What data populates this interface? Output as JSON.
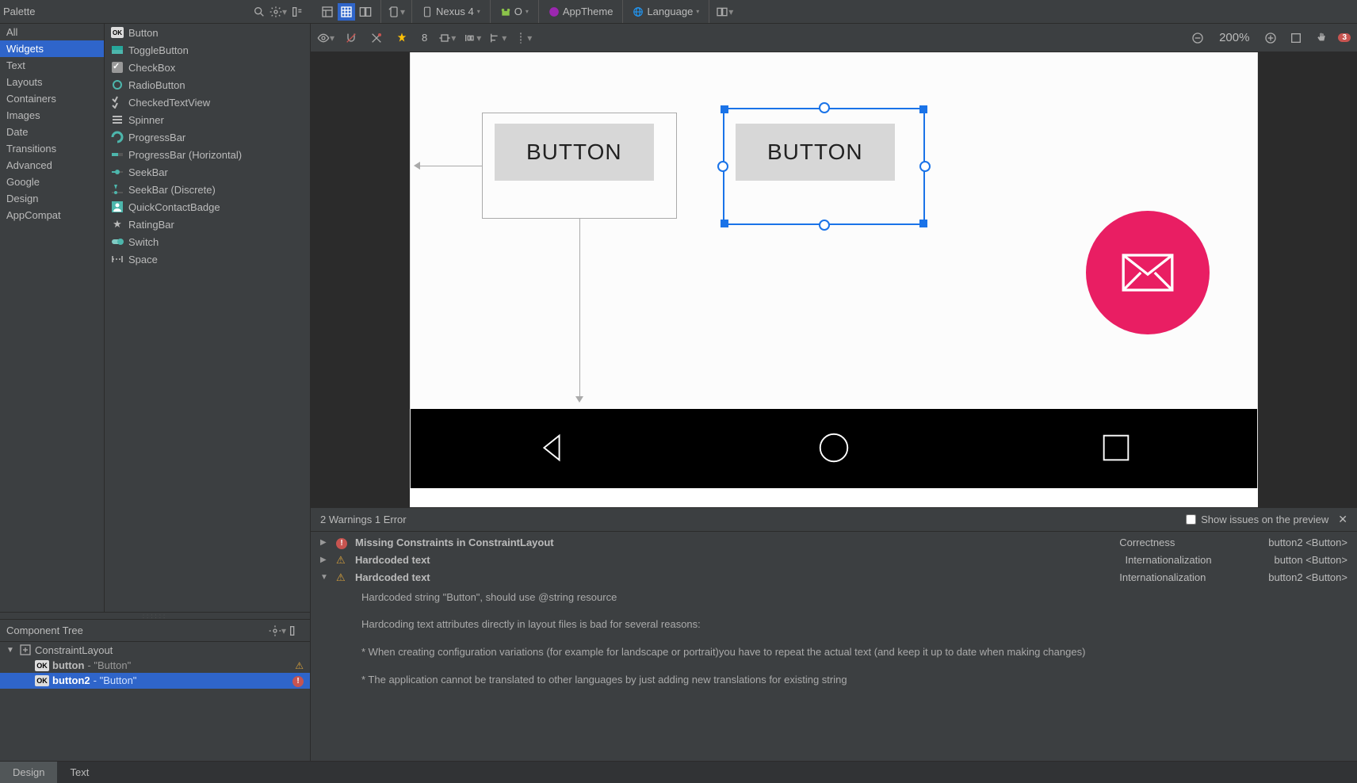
{
  "palette": {
    "title": "Palette",
    "categories": [
      "All",
      "Widgets",
      "Text",
      "Layouts",
      "Containers",
      "Images",
      "Date",
      "Transitions",
      "Advanced",
      "Google",
      "Design",
      "AppCompat"
    ],
    "selectedCategory": "Widgets",
    "items": [
      "Button",
      "ToggleButton",
      "CheckBox",
      "RadioButton",
      "CheckedTextView",
      "Spinner",
      "ProgressBar",
      "ProgressBar (Horizontal)",
      "SeekBar",
      "SeekBar (Discrete)",
      "QuickContactBadge",
      "RatingBar",
      "Switch",
      "Space"
    ]
  },
  "componentTree": {
    "title": "Component Tree",
    "root": "ConstraintLayout",
    "children": [
      {
        "id": "button",
        "type": "\"Button\"",
        "status": "warn"
      },
      {
        "id": "button2",
        "type": "\"Button\"",
        "status": "err",
        "selected": true
      }
    ]
  },
  "toolbar": {
    "device": "Nexus 4",
    "api": "O",
    "theme": "AppTheme",
    "locale": "Language"
  },
  "designToolbar": {
    "marginDefault": "8",
    "zoom": "200%",
    "errorCount": "3"
  },
  "canvas": {
    "button1Label": "BUTTON",
    "button2Label": "BUTTON"
  },
  "issues": {
    "summary": "2 Warnings 1 Error",
    "showOnPreviewLabel": "Show issues on the preview",
    "rows": [
      {
        "expanded": false,
        "severity": "err",
        "title": "Missing Constraints in ConstraintLayout",
        "category": "Correctness",
        "source": "button2 <Button>"
      },
      {
        "expanded": false,
        "severity": "warn",
        "title": "Hardcoded text",
        "category": "Internationalization",
        "source": "button <Button>"
      },
      {
        "expanded": true,
        "severity": "warn",
        "title": "Hardcoded text",
        "category": "Internationalization",
        "source": "button2 <Button>"
      }
    ],
    "detail": {
      "line1": "Hardcoded string \"Button\", should use @string resource",
      "line2": "Hardcoding text attributes directly in layout files is bad for several reasons:",
      "line3": "* When creating configuration variations (for example for landscape or portrait)you have to repeat the actual text (and keep it up to date when making changes)",
      "line4": "* The application cannot be translated to other languages by just adding new translations for existing string"
    }
  },
  "bottomTabs": {
    "design": "Design",
    "text": "Text"
  }
}
